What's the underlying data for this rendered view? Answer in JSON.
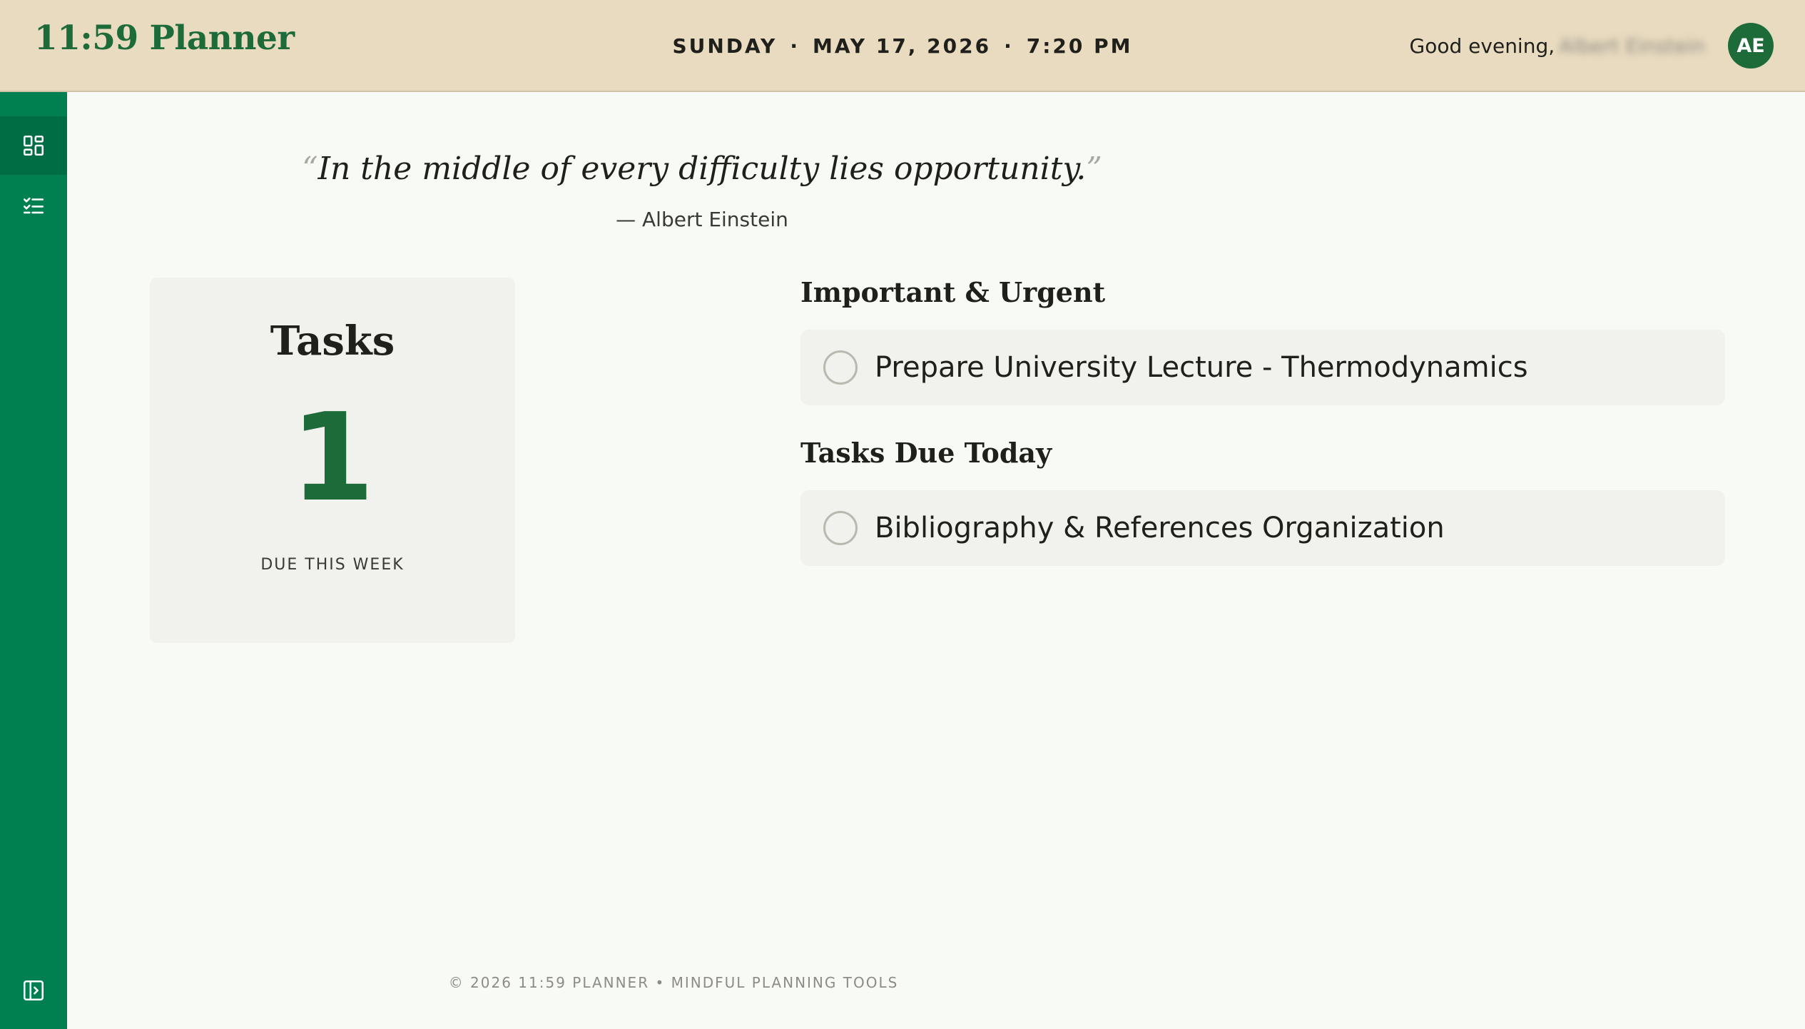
{
  "app": {
    "brand": "11:59 Planner"
  },
  "header": {
    "day": "SUNDAY",
    "separator": "·",
    "date": "MAY 17, 2026",
    "time": "7:20 PM",
    "greeting": "Good evening,",
    "user_name": "Albert Einstein",
    "avatar_initials": "AE"
  },
  "sidebar": {
    "items": [
      {
        "icon": "dashboard-icon",
        "active": true
      },
      {
        "icon": "task-list-icon",
        "active": false
      }
    ],
    "bottom_icon": "sidebar-toggle-icon"
  },
  "quote": {
    "open_mark": "“",
    "text": "In the middle of every difficulty lies opportunity.",
    "close_mark": "”",
    "author": "— Albert Einstein"
  },
  "tasks_card": {
    "title": "Tasks",
    "count": "1",
    "subtitle": "DUE THIS WEEK"
  },
  "sections": [
    {
      "title": "Important & Urgent",
      "tasks": [
        "Prepare University Lecture - Thermodynamics"
      ]
    },
    {
      "title": "Tasks Due Today",
      "tasks": [
        "Bibliography & References Organization"
      ]
    }
  ],
  "footer": {
    "text": "© 2026 11:59 PLANNER • MINDFUL PLANNING TOOLS"
  },
  "colors": {
    "header_bg": "#e9dbbf",
    "sidebar_bg": "#008050",
    "brand_green": "#1e6b3a",
    "page_bg": "#f8faf6",
    "card_bg": "#f1f2ee"
  }
}
